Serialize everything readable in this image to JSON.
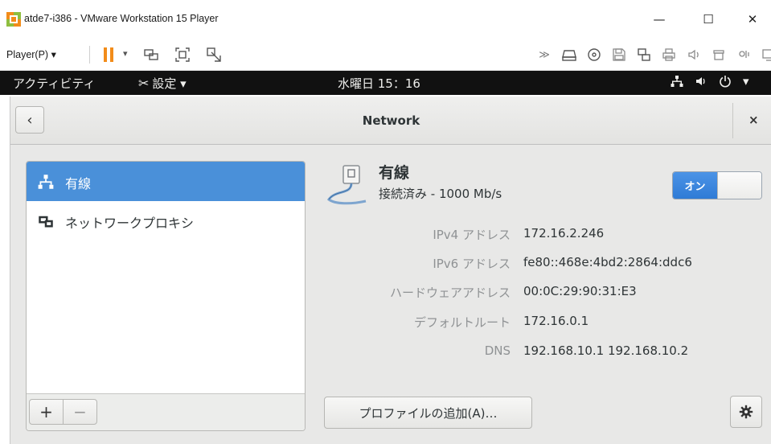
{
  "host_window": {
    "title": "atde7-i386 - VMware Workstation 15 Player",
    "minimize_glyph": "—",
    "maximize_glyph": "☐",
    "close_glyph": "✕"
  },
  "host_toolbar": {
    "player_menu": "Player(P) ▾",
    "icons": [
      "pause-icon",
      "send-ctrl-alt-del-icon",
      "fullscreen-icon",
      "unity-icon",
      "more-icon",
      "hard-disk-icon",
      "cd-dvd-icon",
      "floppy-icon",
      "network-adapter-icon",
      "printer-icon",
      "sound-card-icon",
      "usb-icon",
      "message-log-icon"
    ]
  },
  "gnome_topbar": {
    "activities": "アクティビティ",
    "app_menu": "設定 ▾",
    "clock": "水曜日 15：16"
  },
  "settings": {
    "back_glyph": "‹",
    "title": "Network",
    "close_glyph": "×",
    "sidebar": {
      "items": [
        {
          "label": "有線",
          "icon": "wired-network-icon",
          "selected": true
        },
        {
          "label": "ネットワークプロキシ",
          "icon": "network-proxy-icon",
          "selected": false
        }
      ],
      "add_label": "+",
      "remove_label": "−"
    },
    "connection": {
      "name": "有線",
      "status": "接続済み - 1000 Mb/s",
      "toggle_on_label": "オン",
      "details": [
        {
          "label": "IPv4 アドレス",
          "value": "172.16.2.246"
        },
        {
          "label": "IPv6 アドレス",
          "value": "fe80::468e:4bd2:2864:ddc6"
        },
        {
          "label": "ハードウェアアドレス",
          "value": "00:0C:29:90:31:E3"
        },
        {
          "label": "デフォルトルート",
          "value": "172.16.0.1"
        },
        {
          "label": "DNS",
          "value": "192.168.10.1 192.168.10.2"
        }
      ],
      "add_profile_label": "プロファイルの追加(A)…"
    }
  },
  "colors": {
    "selection": "#4a90d9",
    "toggle_on": "#3584e4",
    "pause": "#f28c1a",
    "topbar": "#111111"
  }
}
